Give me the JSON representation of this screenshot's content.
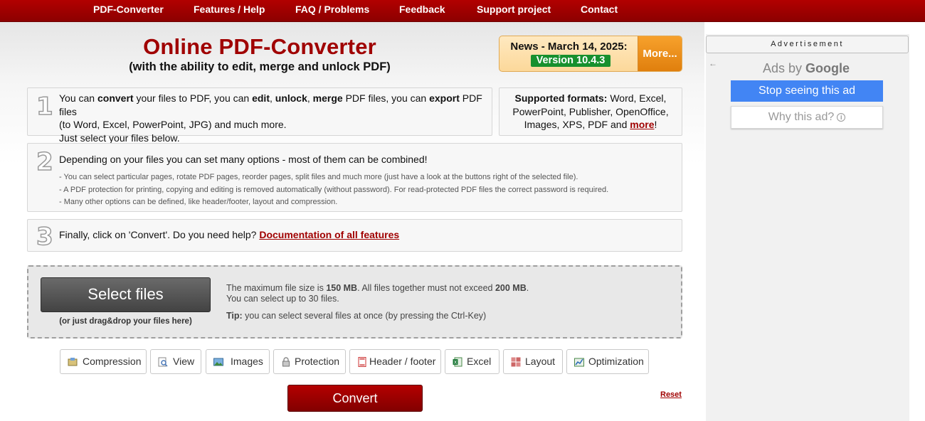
{
  "nav": {
    "items": [
      "PDF-Converter",
      "Features / Help",
      "FAQ / Problems",
      "Feedback",
      "Support project",
      "Contact"
    ]
  },
  "header": {
    "title": "Online PDF-Converter",
    "subtitle": "(with the ability to edit, merge and unlock PDF)"
  },
  "news": {
    "title": "News - March 14, 2025:",
    "version": "Version 10.4.3",
    "more": "More..."
  },
  "step1": {
    "number": "1",
    "line1_a": "You can ",
    "line1_b": "convert",
    "line1_c": " your files to PDF, you can ",
    "line1_d": "edit",
    "line1_e": ", ",
    "line1_f": "unlock",
    "line1_g": ", ",
    "line1_h": "merge",
    "line1_i": " PDF files, you can ",
    "line1_j": "export",
    "line1_k": " PDF files",
    "line2": "(to Word, Excel, PowerPoint, JPG) and much more.",
    "line3": "Just select your files below."
  },
  "formats": {
    "label": "Supported formats:",
    "list_a": " Word, Excel,",
    "list_b": "PowerPoint, Publisher, OpenOffice,",
    "list_c": "Images, XPS, PDF and ",
    "more": "more",
    "end": "!"
  },
  "step2": {
    "number": "2",
    "text": "Depending on your files you can set many options - most of them can be combined!",
    "notes": [
      "- You can select particular pages, rotate PDF pages, reorder pages, split files and much more (just have a look at the buttons right of the selected file).",
      "- A PDF protection for printing, copying and editing is removed automatically (without password). For read-protected PDF files the correct password is required.",
      "- Many other options can be defined, like header/footer, layout and compression."
    ]
  },
  "step3": {
    "number": "3",
    "text": "Finally, click on 'Convert'. Do you need help? ",
    "link": "Documentation of all features"
  },
  "upload": {
    "select_label": "Select files",
    "drag_note": "(or just drag&drop your files here)",
    "max_a": "The maximum file size is ",
    "max_b": "150 MB",
    "max_c": ". All files together must not exceed ",
    "max_d": "200 MB",
    "max_e": ".",
    "count": "You can select up to 30 files.",
    "tip_label": "Tip:",
    "tip_text": " you can select several files at once (by pressing the Ctrl-Key)"
  },
  "options": [
    {
      "label": "Compression",
      "icon": "compression-icon"
    },
    {
      "label": "View",
      "icon": "view-icon"
    },
    {
      "label": "Images",
      "icon": "images-icon"
    },
    {
      "label": "Protection",
      "icon": "lock-icon"
    },
    {
      "label": "Header / footer",
      "icon": "page-icon"
    },
    {
      "label": "Excel",
      "icon": "excel-icon"
    },
    {
      "label": "Layout",
      "icon": "layout-icon"
    },
    {
      "label": "Optimization",
      "icon": "chart-icon"
    }
  ],
  "actions": {
    "convert": "Convert",
    "reset": "Reset"
  },
  "ad": {
    "label": "Advertisement",
    "ads_by": "Ads by ",
    "google": "Google",
    "stop": "Stop seeing this ad",
    "why": "Why this ad?"
  },
  "colors": {
    "brand_red": "#a00000",
    "news_green": "#17902e",
    "news_orange": "#f09020",
    "google_blue": "#4285f4"
  }
}
